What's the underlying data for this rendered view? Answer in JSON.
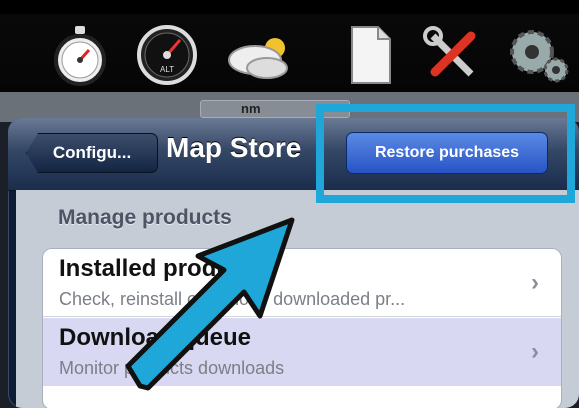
{
  "toolbar": {
    "icons": [
      "stopwatch-icon",
      "speedometer-icon",
      "weather-cloud-icon",
      "document-icon",
      "tools-icon",
      "gear-icon"
    ]
  },
  "map_strip": {
    "scale_label": "nm"
  },
  "navbar": {
    "back_label": "Configu...",
    "title": "Map Store",
    "restore_label": "Restore purchases"
  },
  "section": {
    "header": "Manage products"
  },
  "cells": [
    {
      "title": "Installed products",
      "subtitle": "Check, reinstall or remove downloaded pr..."
    },
    {
      "title": "Download queue",
      "subtitle": "Monitor products downloads"
    }
  ],
  "colors": {
    "highlight": "#1ea7d8",
    "arrow_fill": "#1ea7d8",
    "restore_button": "#3a6ad8",
    "selected_row": "#d8d8f2"
  }
}
